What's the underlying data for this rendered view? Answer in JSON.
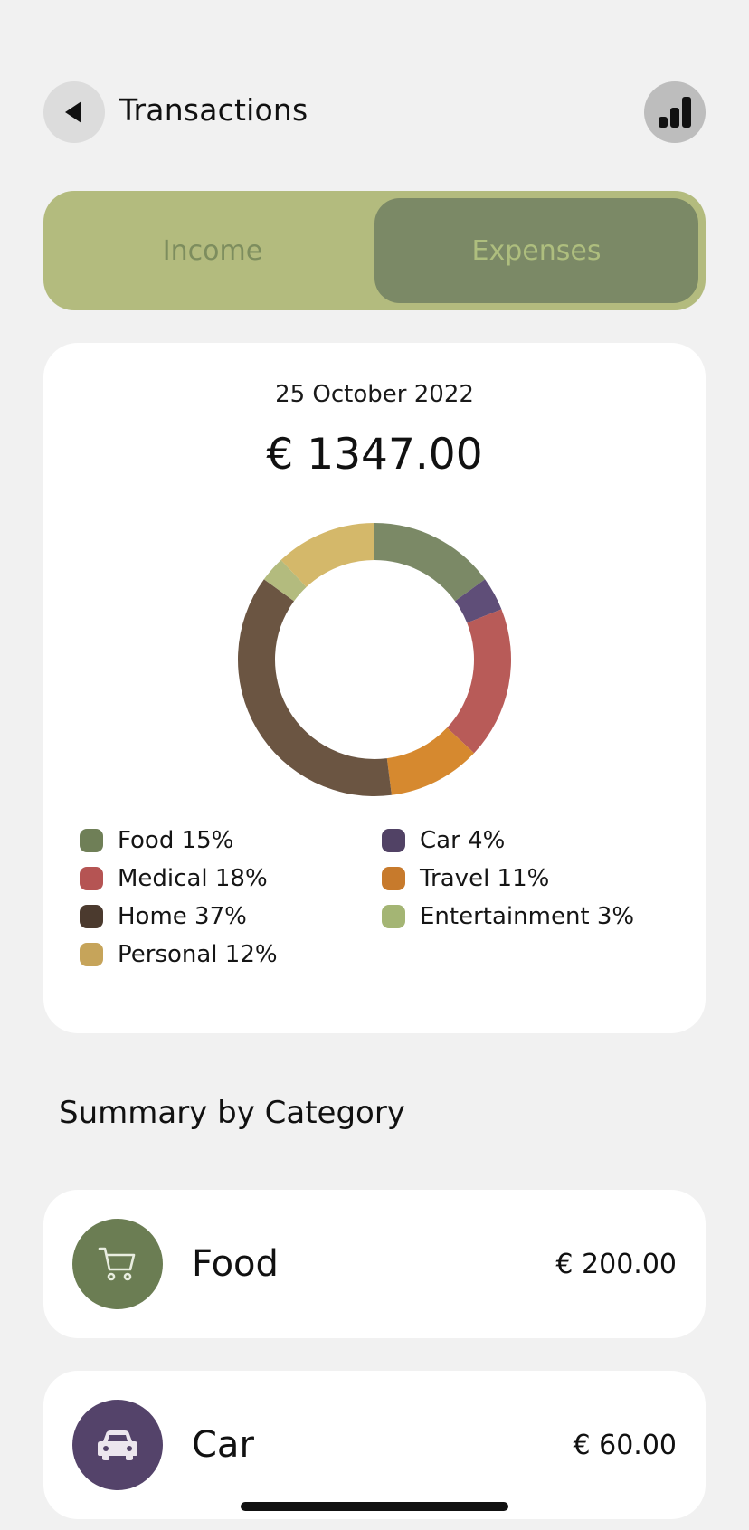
{
  "header": {
    "title": "Transactions",
    "back_icon": "chevron-left-icon",
    "stats_icon": "bar-chart-icon"
  },
  "tabs": [
    {
      "label": "Income",
      "active": false
    },
    {
      "label": "Expenses",
      "active": true
    }
  ],
  "summary_card": {
    "date": "25 October 2022",
    "total": "€ 1347.00"
  },
  "chart_data": {
    "type": "pie",
    "donut": true,
    "categories": [
      "Food",
      "Car",
      "Medical",
      "Travel",
      "Home",
      "Entertainment",
      "Personal"
    ],
    "values": [
      15,
      4,
      18,
      11,
      37,
      3,
      12
    ],
    "unit": "%",
    "colors": [
      "#7b8966",
      "#5f4e78",
      "#b85b58",
      "#d6892f",
      "#6b5542",
      "#b3bb7e",
      "#d4b86a"
    ],
    "legend": [
      {
        "label": "Food 15%",
        "color": "#6f7f57"
      },
      {
        "label": "Car 4%",
        "color": "#514265"
      },
      {
        "label": "Medical 18%",
        "color": "#b55453"
      },
      {
        "label": "Travel 11%",
        "color": "#c77a2c"
      },
      {
        "label": "Home 37%",
        "color": "#4b3a2e"
      },
      {
        "label": "Entertainment 3%",
        "color": "#a4b574"
      },
      {
        "label": "Personal 12%",
        "color": "#c6a45a"
      }
    ]
  },
  "section_title": "Summary by Category",
  "categories": [
    {
      "name": "Food",
      "amount": "€ 200.00",
      "icon": "cart-icon",
      "color": "#6b7d53"
    },
    {
      "name": "Car",
      "amount": "€ 60.00",
      "icon": "car-icon",
      "color": "#54436a"
    }
  ]
}
